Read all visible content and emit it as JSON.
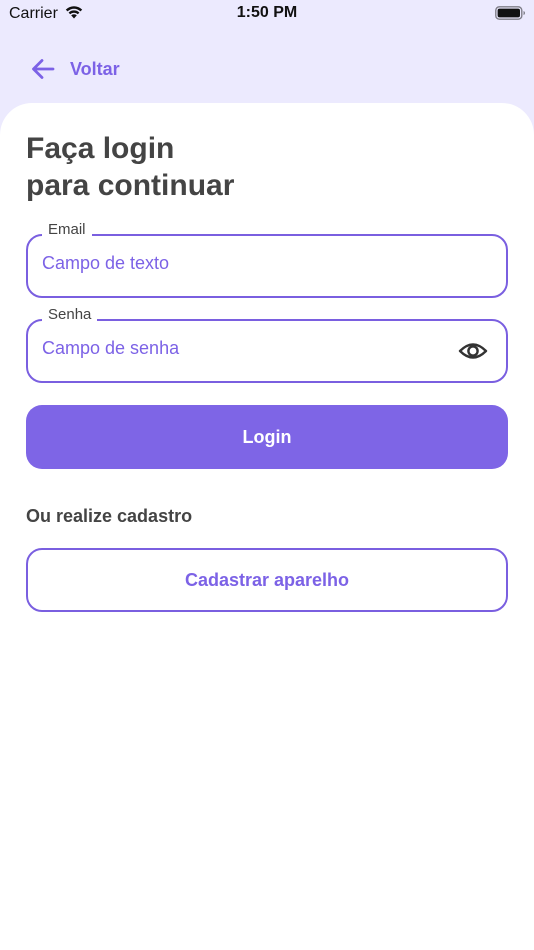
{
  "status_bar": {
    "carrier": "Carrier",
    "time": "1:50 PM"
  },
  "nav": {
    "back_label": "Voltar",
    "back_icon": "arrow-left-icon"
  },
  "title": {
    "line1": "Faça login",
    "line2": "para continuar"
  },
  "form": {
    "email": {
      "label": "Email",
      "value": "Campo de texto"
    },
    "password": {
      "label": "Senha",
      "value": "Campo de senha",
      "toggle_icon": "eye-icon"
    },
    "login_label": "Login"
  },
  "register": {
    "prompt": "Ou realize cadastro",
    "button_label": "Cadastrar aparelho"
  },
  "colors": {
    "accent": "#7E65E6",
    "header_bg": "#ECEAFE",
    "text_dark": "#444444"
  }
}
